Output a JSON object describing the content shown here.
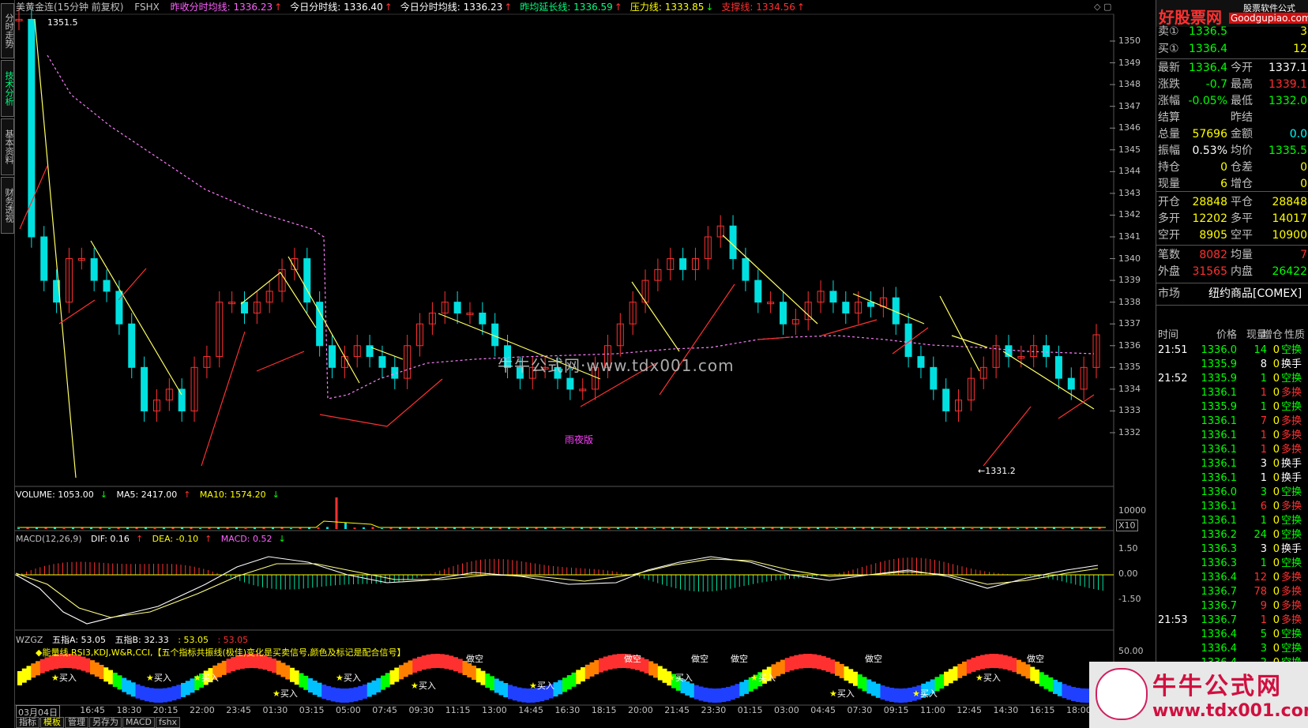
{
  "title_bar": {
    "symbol": "美黄金连(15分钟 前复权)",
    "indicator": "FSHX",
    "items": [
      {
        "label": "昨收分时均线: 1336.23",
        "arrow": "↑",
        "color": "#ff60ff"
      },
      {
        "label": "今日分时线: 1336.40",
        "arrow": "↑",
        "color": "#ffffff"
      },
      {
        "label": "今日分时均线: 1336.23",
        "arrow": "↑",
        "color": "#ffffff"
      },
      {
        "label": "昨均延长线: 1336.59",
        "arrow": "↑",
        "color": "#00ff80"
      },
      {
        "label": "压力线: 1333.85",
        "arrow": "↓",
        "color": "#ffff00"
      },
      {
        "label": "支撑线: 1334.56",
        "arrow": "↑",
        "color": "#ff3030"
      }
    ]
  },
  "sidebar": {
    "tabs": [
      "分时走势",
      "技术分析",
      "基本资料",
      "财务透视"
    ]
  },
  "main_chart": {
    "high_label": "1351.5",
    "low_label": "←1331.2",
    "badge": "雨夜版",
    "watermark": "牛牛公式网·www.tdx001.com",
    "y_ticks": [
      "1350",
      "1349",
      "1348",
      "1347",
      "1346",
      "1345",
      "1344",
      "1343",
      "1342",
      "1341",
      "1340",
      "1339",
      "1338",
      "1337",
      "1336",
      "1335",
      "1334",
      "1333",
      "1332"
    ]
  },
  "volume_panel": {
    "label": "VOLUME: 1053.00",
    "ma5": "MA5: 2417.00",
    "ma10": "MA10: 1574.20",
    "y_tick": "10000",
    "multiplier": "X10"
  },
  "macd_panel": {
    "label": "MACD(12,26,9)",
    "dif": "DIF: 0.16",
    "dea": "DEA: -0.10",
    "macd": "MACD: 0.52",
    "y_ticks": [
      "1.50",
      "0.00",
      "-1.50"
    ]
  },
  "wzgz_panel": {
    "label": "WZGZ",
    "a": "五指A: 53.05",
    "b": "五指B: 32.33",
    "c": ": 53.05",
    "d": ": 53.05",
    "desc": "◆能量线,RSI3,KDJ,W&R,CCI,【五个指标共振线(极佳)变化是买卖信号,颜色及标记是配合信号】",
    "y_tick": "50.00",
    "buy_label": "买入",
    "sell_label": "做空"
  },
  "x_axis": [
    "03月04日",
    "16:45",
    "18:30",
    "20:15",
    "22:00",
    "23:45",
    "01:30",
    "03:15",
    "05:00",
    "07:45",
    "09:30",
    "11:15",
    "13:00",
    "14:45",
    "16:30",
    "18:15",
    "20:00",
    "21:45",
    "23:30",
    "01:15",
    "03:00",
    "04:45",
    "07:30",
    "09:15",
    "11:00",
    "12:45",
    "14:30",
    "16:15",
    "18:00"
  ],
  "bottom_tabs": [
    "指标",
    "模板",
    "管理",
    "另存为",
    "MACD",
    "fshx"
  ],
  "quote": {
    "sell1": {
      "k": "卖①",
      "price": "1336.5",
      "vol": "3"
    },
    "buy1": {
      "k": "买①",
      "price": "1336.4",
      "vol": "12"
    },
    "rows1": [
      {
        "k1": "最新",
        "v1": "1336.4",
        "c1": "#00ff00",
        "k2": "今开",
        "v2": "1337.1",
        "c2": "#ffffff"
      },
      {
        "k1": "涨跌",
        "v1": "-0.7",
        "c1": "#00ff00",
        "k2": "最高",
        "v2": "1339.1",
        "c2": "#ff3030"
      },
      {
        "k1": "涨幅",
        "v1": "-0.05%",
        "c1": "#00ff00",
        "k2": "最低",
        "v2": "1332.0",
        "c2": "#00ff00"
      },
      {
        "k1": "结算",
        "v1": "",
        "c1": "#ffffff",
        "k2": "昨结",
        "v2": "",
        "c2": "#ffffff"
      },
      {
        "k1": "总量",
        "v1": "57696",
        "c1": "#ffff00",
        "k2": "金额",
        "v2": "0.0",
        "c2": "#00ffff"
      },
      {
        "k1": "振幅",
        "v1": "0.53%",
        "c1": "#ffffff",
        "k2": "均价",
        "v2": "1335.5",
        "c2": "#00ff00"
      },
      {
        "k1": "持仓",
        "v1": "0",
        "c1": "#ffff00",
        "k2": "仓差",
        "v2": "0",
        "c2": "#ffff00"
      },
      {
        "k1": "现量",
        "v1": "6",
        "c1": "#ffff00",
        "k2": "增仓",
        "v2": "0",
        "c2": "#ffff00"
      }
    ],
    "rows2": [
      {
        "k1": "开仓",
        "v1": "28848",
        "c1": "#ffff00",
        "k2": "平仓",
        "v2": "28848",
        "c2": "#ffff00"
      },
      {
        "k1": "多开",
        "v1": "12202",
        "c1": "#ffff00",
        "k2": "多平",
        "v2": "14017",
        "c2": "#ffff00"
      },
      {
        "k1": "空开",
        "v1": "8905",
        "c1": "#ffff00",
        "k2": "空平",
        "v2": "10900",
        "c2": "#ffff00"
      }
    ],
    "rows3": [
      {
        "k1": "笔数",
        "v1": "8082",
        "c1": "#ff3030",
        "k2": "均量",
        "v2": "7",
        "c2": "#ff3030"
      },
      {
        "k1": "外盘",
        "v1": "31565",
        "c1": "#ff3030",
        "k2": "内盘",
        "v2": "26422",
        "c2": "#00ff00"
      }
    ],
    "market_label": "市场",
    "market_value": "纽约商品[COMEX]"
  },
  "ticks": {
    "headers": [
      "时间",
      "价格",
      "现量",
      "增仓",
      "性质"
    ],
    "rows": [
      {
        "t": "21:51",
        "p": "1336.0",
        "pc": "#00ff00",
        "v": "14",
        "vc": "#00ff00",
        "o": "0",
        "n": "空换",
        "nc": "#00ff00"
      },
      {
        "t": "",
        "p": "1335.9",
        "pc": "#00ff00",
        "v": "8",
        "vc": "#ffffff",
        "o": "0",
        "n": "换手",
        "nc": "#ffffff"
      },
      {
        "t": "21:52",
        "p": "1335.9",
        "pc": "#00ff00",
        "v": "1",
        "vc": "#00ff00",
        "o": "0",
        "n": "空换",
        "nc": "#00ff00"
      },
      {
        "t": "",
        "p": "1336.1",
        "pc": "#00ff00",
        "v": "1",
        "vc": "#ff3030",
        "o": "0",
        "n": "多换",
        "nc": "#ff3030"
      },
      {
        "t": "",
        "p": "1335.9",
        "pc": "#00ff00",
        "v": "1",
        "vc": "#00ff00",
        "o": "0",
        "n": "空换",
        "nc": "#00ff00"
      },
      {
        "t": "",
        "p": "1336.1",
        "pc": "#00ff00",
        "v": "7",
        "vc": "#ff3030",
        "o": "0",
        "n": "多换",
        "nc": "#ff3030"
      },
      {
        "t": "",
        "p": "1336.1",
        "pc": "#00ff00",
        "v": "1",
        "vc": "#ff3030",
        "o": "0",
        "n": "多换",
        "nc": "#ff3030"
      },
      {
        "t": "",
        "p": "1336.1",
        "pc": "#00ff00",
        "v": "1",
        "vc": "#ff3030",
        "o": "0",
        "n": "多换",
        "nc": "#ff3030"
      },
      {
        "t": "",
        "p": "1336.1",
        "pc": "#00ff00",
        "v": "3",
        "vc": "#ffffff",
        "o": "0",
        "n": "换手",
        "nc": "#ffffff"
      },
      {
        "t": "",
        "p": "1336.1",
        "pc": "#00ff00",
        "v": "1",
        "vc": "#ffffff",
        "o": "0",
        "n": "换手",
        "nc": "#ffffff"
      },
      {
        "t": "",
        "p": "1336.0",
        "pc": "#00ff00",
        "v": "3",
        "vc": "#00ff00",
        "o": "0",
        "n": "空换",
        "nc": "#00ff00"
      },
      {
        "t": "",
        "p": "1336.1",
        "pc": "#00ff00",
        "v": "6",
        "vc": "#ff3030",
        "o": "0",
        "n": "多换",
        "nc": "#ff3030"
      },
      {
        "t": "",
        "p": "1336.1",
        "pc": "#00ff00",
        "v": "1",
        "vc": "#00ff00",
        "o": "0",
        "n": "空换",
        "nc": "#00ff00"
      },
      {
        "t": "",
        "p": "1336.2",
        "pc": "#00ff00",
        "v": "24",
        "vc": "#00ff00",
        "o": "0",
        "n": "空换",
        "nc": "#00ff00"
      },
      {
        "t": "",
        "p": "1336.3",
        "pc": "#00ff00",
        "v": "3",
        "vc": "#ffffff",
        "o": "0",
        "n": "换手",
        "nc": "#ffffff"
      },
      {
        "t": "",
        "p": "1336.3",
        "pc": "#00ff00",
        "v": "1",
        "vc": "#00ff00",
        "o": "0",
        "n": "空换",
        "nc": "#00ff00"
      },
      {
        "t": "",
        "p": "1336.4",
        "pc": "#00ff00",
        "v": "12",
        "vc": "#ff3030",
        "o": "0",
        "n": "多换",
        "nc": "#ff3030"
      },
      {
        "t": "",
        "p": "1336.7",
        "pc": "#00ff00",
        "v": "78",
        "vc": "#ff3030",
        "o": "0",
        "n": "多换",
        "nc": "#ff3030"
      },
      {
        "t": "",
        "p": "1336.7",
        "pc": "#00ff00",
        "v": "9",
        "vc": "#ff3030",
        "o": "0",
        "n": "多换",
        "nc": "#ff3030"
      },
      {
        "t": "21:53",
        "p": "1336.7",
        "pc": "#00ff00",
        "v": "1",
        "vc": "#ff3030",
        "o": "0",
        "n": "多换",
        "nc": "#ff3030"
      },
      {
        "t": "",
        "p": "1336.4",
        "pc": "#00ff00",
        "v": "5",
        "vc": "#00ff00",
        "o": "0",
        "n": "空换",
        "nc": "#00ff00"
      },
      {
        "t": "",
        "p": "1336.4",
        "pc": "#00ff00",
        "v": "3",
        "vc": "#00ff00",
        "o": "0",
        "n": "空换",
        "nc": "#00ff00"
      },
      {
        "t": "",
        "p": "1336.4",
        "pc": "#00ff00",
        "v": "2",
        "vc": "#00ff00",
        "o": "0",
        "n": "空换",
        "nc": "#00ff00"
      }
    ]
  },
  "logos": {
    "top_brand": "好股票网",
    "top_url": "Goodgupiao.com",
    "top_sub": "股票软件公式",
    "bottom_brand": "牛牛公式网",
    "bottom_url": "www.tdx001.com"
  }
}
